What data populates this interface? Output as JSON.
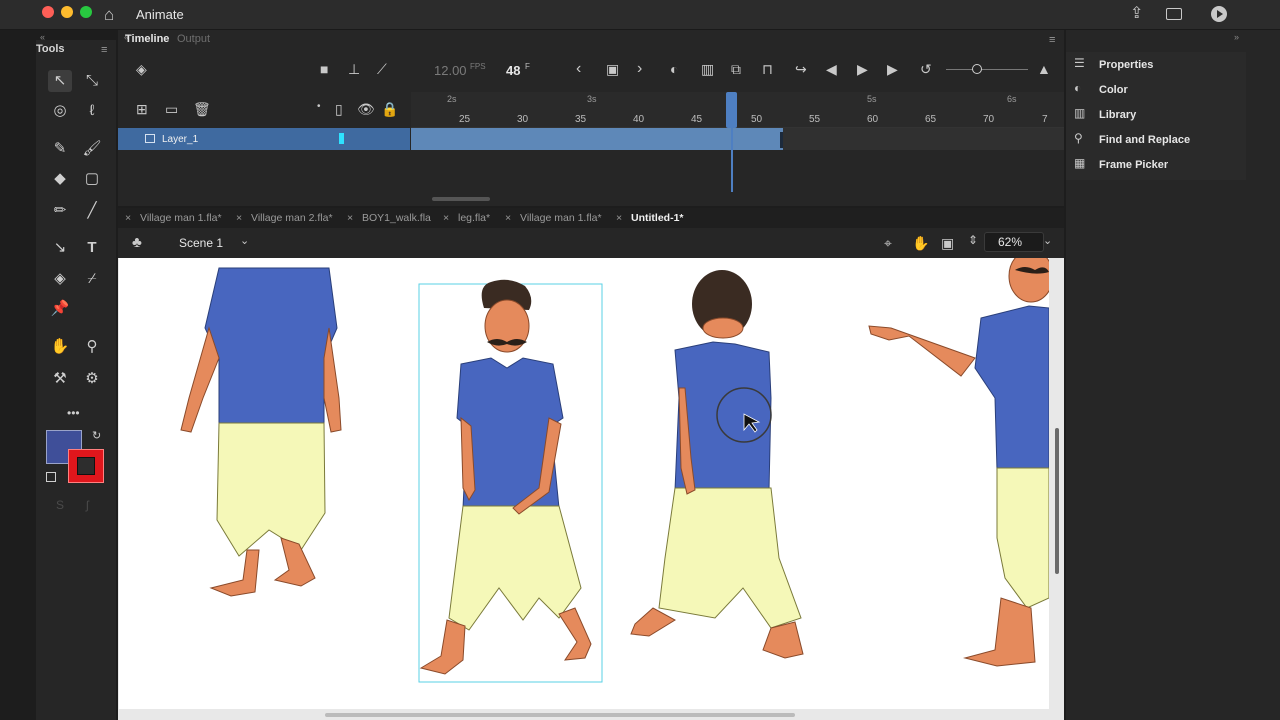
{
  "window": {
    "app_name": "Animate"
  },
  "tools_panel": {
    "title": "Tools",
    "more": "•••"
  },
  "timeline": {
    "tabs": [
      {
        "label": "Timeline",
        "active": true
      },
      {
        "label": "Output",
        "active": false
      }
    ],
    "fps": "12.00",
    "fps_unit": "FPS",
    "frame": "48",
    "frame_unit": "F",
    "ruler_seconds": [
      "2s",
      "3s",
      "5s",
      "6s"
    ],
    "ruler_frames": [
      "25",
      "30",
      "35",
      "40",
      "45",
      "50",
      "55",
      "60",
      "65",
      "70",
      "7"
    ],
    "layer_name": "Layer_1"
  },
  "doc_tabs": [
    {
      "label": "Village man 1.fla*",
      "active": false
    },
    {
      "label": "Village man 2.fla*",
      "active": false
    },
    {
      "label": "BOY1_walk.fla",
      "active": false
    },
    {
      "label": "leg.fla*",
      "active": false
    },
    {
      "label": "Village man 1.fla*",
      "active": false
    },
    {
      "label": "Untitled-1*",
      "active": true
    }
  ],
  "scene": {
    "label": "Scene 1",
    "zoom": "62%"
  },
  "right_panel": {
    "items": [
      "Properties",
      "Color",
      "Library",
      "Find and Replace",
      "Frame Picker"
    ]
  },
  "colors": {
    "fill": "#3f4f99",
    "stroke": "#e0161c",
    "shirt": "#4866bf",
    "dhoti": "#f5f8b8",
    "skin": "#e58a5c",
    "hair": "#3a2b22",
    "layer_highlight": "#3f6aa0"
  }
}
